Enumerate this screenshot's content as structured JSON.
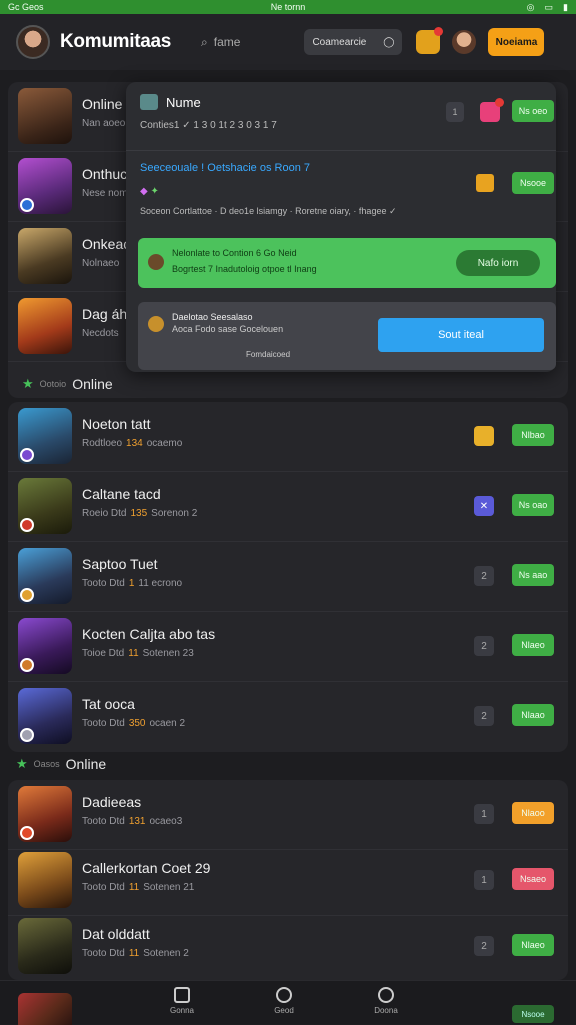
{
  "statusbar": {
    "left": "Gc Geos",
    "center": "Ne tornn",
    "right_icons": [
      "wifi-icon",
      "battery-icon",
      "signal-icon"
    ]
  },
  "header": {
    "title": "Komumitaas",
    "search_label": "fame",
    "pill_label": "Coamearcie",
    "button_label": "Noeiama"
  },
  "top_section": {
    "rows": [
      {
        "title": "Online",
        "meta": "Nan aoeo"
      },
      {
        "title": "Onthuc",
        "meta": "Nese nom"
      },
      {
        "title": "Onkeac",
        "meta": "Nolnaeo"
      },
      {
        "title": "Dag áh",
        "meta": "Necdots"
      }
    ]
  },
  "popup": {
    "head": "Nume",
    "sub": "Conties1  ✓  1 3 0 1t 2 3 0 3 1  7",
    "badge_num": "1",
    "go_label": "Ns oeo",
    "info_blue": "Seeceouale ! Oetshacie os Roon  7",
    "info2": "✦",
    "info3": "Soceon Cortlattoe · D deo1e lsiamgy · Roretne oiary,  ·  fhagee  ✓",
    "go2_label": "Nsooe",
    "green_t1": "Nelonlate to Contion 6 Go Neid",
    "green_t2": "Bogrtest 7 Inadutoloig otpoe tl Inang",
    "green_btn": "Nafo iorn",
    "gray_t1": "Daelotao Seesalaso",
    "gray_t2": "Aoca Fodo sase Gocelouen",
    "gray_t3": "Fomdaicoed",
    "blue_btn": "Sout iteal"
  },
  "section2": {
    "label": "Online",
    "small": "Ootoio",
    "rows": [
      {
        "title": "Noeton tatt",
        "meta_a": "Rodtloeo",
        "meta_b": "134",
        "meta_c": "ocaemo",
        "ctrl": "",
        "act": "Nlbao",
        "act_color": "green"
      },
      {
        "title": "Caltane tacd",
        "meta_a": "Roeio Dtd",
        "meta_b": "135",
        "meta_c": "Sorenon 2",
        "ctrl": "",
        "act": "Ns oao",
        "act_color": "green"
      },
      {
        "title": "Saptoo Tuet",
        "meta_a": "Tooto Dtd",
        "meta_b": "1",
        "meta_c": "11 ecrono",
        "ctrl": "2",
        "act": "Ns aao",
        "act_color": "green"
      },
      {
        "title": "Kocten Caljta abo tas",
        "meta_a": "Toioe Dtd",
        "meta_b": "11",
        "meta_c": "Sotenen 23",
        "ctrl": "2",
        "act": "Nlaeo",
        "act_color": "green"
      },
      {
        "title": "Tat ooca",
        "meta_a": "Tooto Dtd",
        "meta_b": "350",
        "meta_c": "ocaen 2",
        "ctrl": "2",
        "act": "Nlaao",
        "act_color": "green"
      }
    ]
  },
  "section3": {
    "label": "Online",
    "small": "Oasos",
    "rows": [
      {
        "title": "Dadieeas",
        "meta_a": "Tooto Dtd",
        "meta_b": "131",
        "meta_c": "ocaeo3",
        "ctrl": "1",
        "act": "Nlaoo",
        "act_color": "orange"
      },
      {
        "title": "Callerkortan Coet 29",
        "meta_a": "Tooto Dtd",
        "meta_b": "11",
        "meta_c": "Sotenen 21",
        "ctrl": "1",
        "act": "Nsaeo",
        "act_color": "red"
      },
      {
        "title": "Dat olddatt",
        "meta_a": "Tooto Dtd",
        "meta_b": "11",
        "meta_c": "Sotenen 2",
        "ctrl": "2",
        "act": "Nlaeo",
        "act_color": "green"
      }
    ]
  },
  "bottom_nav": {
    "items": [
      {
        "label": "Gonna"
      },
      {
        "label": "Geod"
      },
      {
        "label": "Doona"
      }
    ],
    "act_label": "Nsooe"
  }
}
